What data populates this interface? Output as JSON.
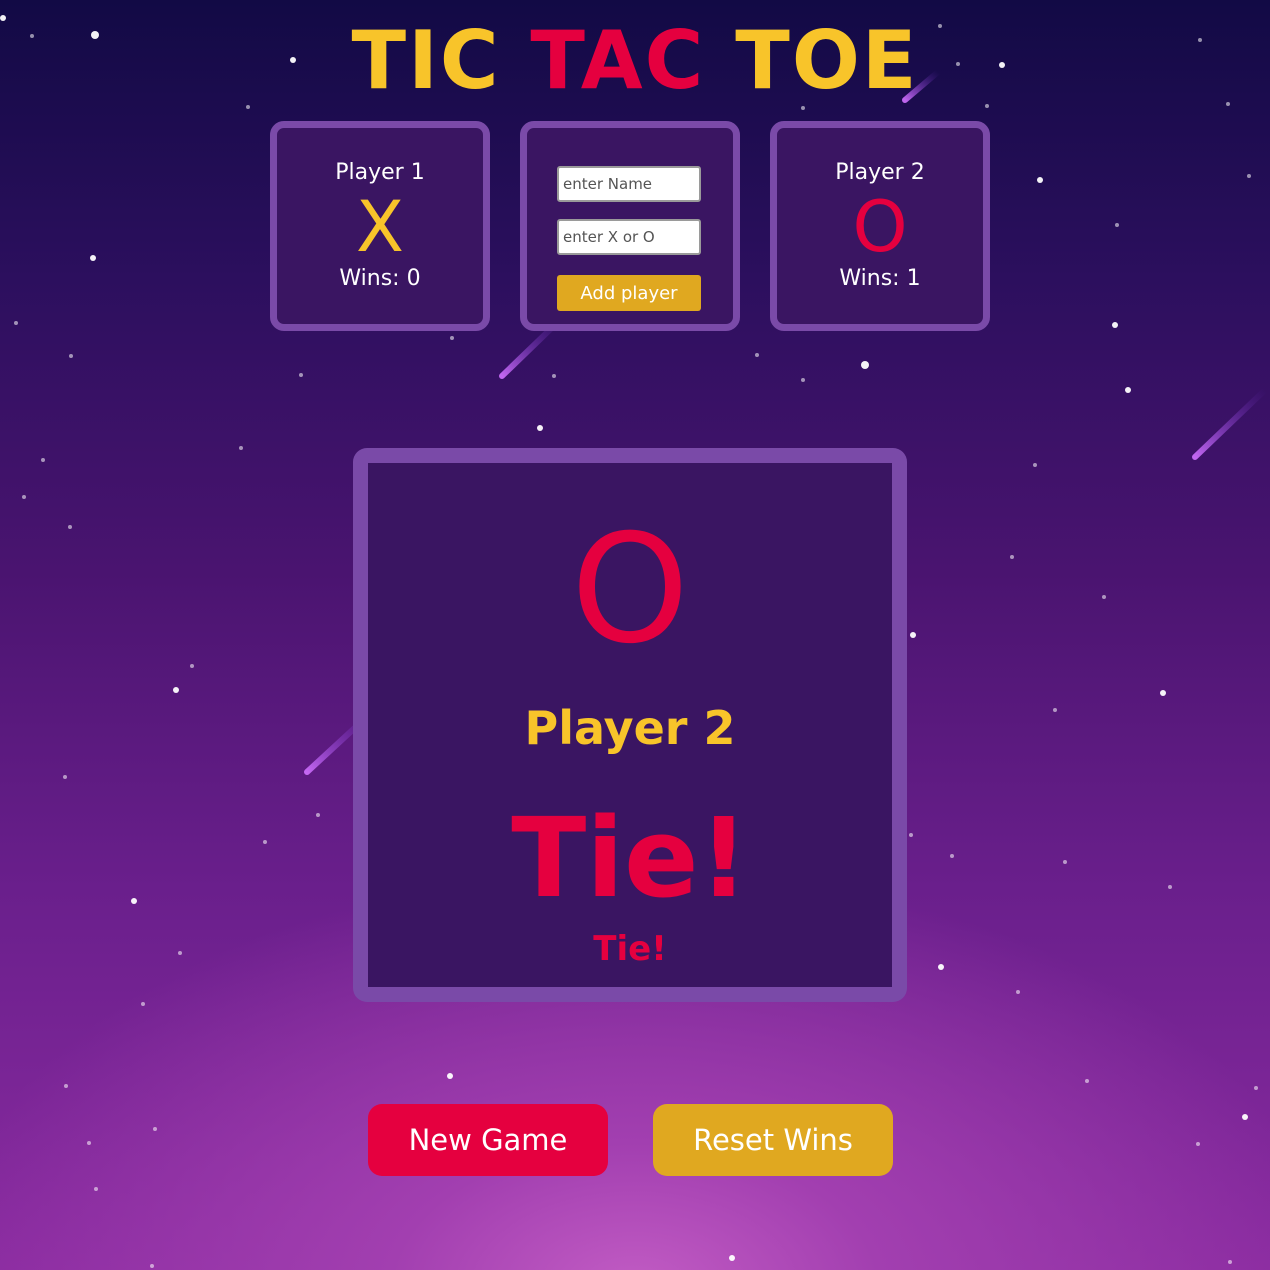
{
  "title": {
    "part1": "TIC",
    "part2": "TAC",
    "part3": "TOE"
  },
  "player1": {
    "label": "Player 1",
    "mark": "X",
    "wins": "Wins: 0"
  },
  "player2": {
    "label": "Player 2",
    "mark": "O",
    "wins": "Wins: 1"
  },
  "add_player": {
    "name_placeholder": "enter Name",
    "mark_placeholder": "enter X or O",
    "button_label": "Add player"
  },
  "board": {
    "current_mark": "O",
    "current_player": "Player 2",
    "result": "Tie!",
    "result_small": "Tie!"
  },
  "controls": {
    "new_game": "New Game",
    "reset_wins": "Reset Wins"
  },
  "colors": {
    "yellow": "#f8c42a",
    "red": "#e5003f",
    "panel": "#3a1562",
    "border": "#7a4aa8",
    "gold_button": "#e0a820"
  }
}
